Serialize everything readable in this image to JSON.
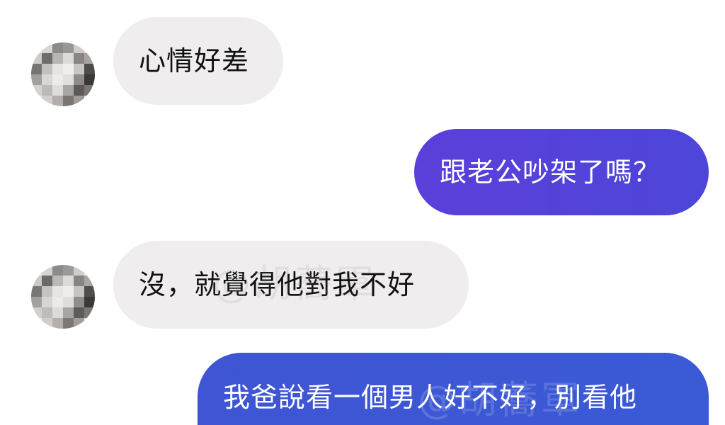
{
  "messages": [
    {
      "side": "incoming",
      "text": "心情好差"
    },
    {
      "side": "outgoing",
      "text": "跟老公吵架了嗎？"
    },
    {
      "side": "incoming",
      "text": "沒，就覺得他對我不好"
    },
    {
      "side": "outgoing",
      "text": "我爸說看一個男人好不好，別看他"
    }
  ],
  "watermark": "@胡蕎軍",
  "colors": {
    "incoming_bubble": "#efeded",
    "outgoing_bubble_1": "#5b3fd9",
    "outgoing_bubble_2": "#3f55d3",
    "background": "#ffffff"
  },
  "avatar": {
    "icon": "blurred-avatar-icon"
  }
}
